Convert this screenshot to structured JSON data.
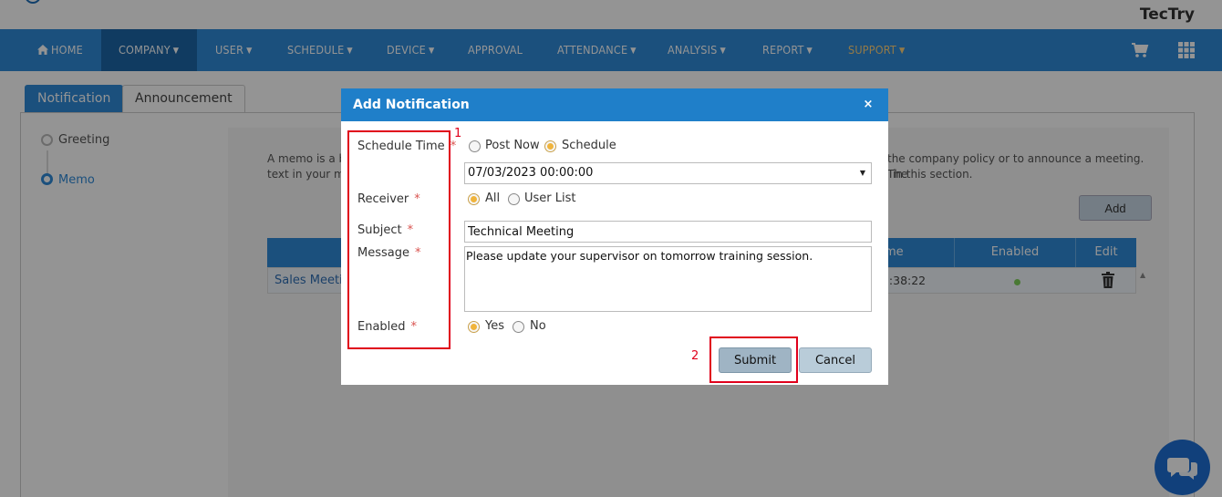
{
  "brand": "TecTry",
  "nav": {
    "items": [
      {
        "label": "HOME",
        "caret": false
      },
      {
        "label": "COMPANY",
        "caret": true
      },
      {
        "label": "USER",
        "caret": true
      },
      {
        "label": "SCHEDULE",
        "caret": true
      },
      {
        "label": "DEVICE",
        "caret": true
      },
      {
        "label": "APPROVAL",
        "caret": false
      },
      {
        "label": "ATTENDANCE",
        "caret": true
      },
      {
        "label": "ANALYSIS",
        "caret": true
      },
      {
        "label": "REPORT",
        "caret": true
      },
      {
        "label": "SUPPORT",
        "caret": true
      }
    ],
    "active": "COMPANY",
    "caret_glyph": "▼"
  },
  "tabs": [
    {
      "label": "Notification",
      "active": true
    },
    {
      "label": "Announcement",
      "active": false
    }
  ],
  "sidebar": {
    "items": [
      {
        "label": "Greeting",
        "active": false
      },
      {
        "label": "Memo",
        "active": true
      }
    ]
  },
  "memo": {
    "description_left": "A memo is a b",
    "description_left_2": "text in your m",
    "description_right": "the company policy or to announce a meeting. The",
    "description_right_2": "in this section.",
    "add_label": "Add"
  },
  "table": {
    "headers": {
      "time_partial": "me",
      "enabled": "Enabled",
      "edit": "Edit"
    },
    "rows": [
      {
        "subject": "Sales Meetin",
        "time_partial": "13:38:22",
        "enabled": true
      }
    ]
  },
  "modal": {
    "title": "Add Notification",
    "close_glyph": "×",
    "labels": {
      "schedule_time": "Schedule Time",
      "receiver": "Receiver",
      "subject": "Subject",
      "message": "Message",
      "enabled": "Enabled",
      "required_mark": "*"
    },
    "schedule_options": [
      {
        "label": "Post Now",
        "checked": false
      },
      {
        "label": "Schedule",
        "checked": true
      }
    ],
    "schedule_datetime": "07/03/2023 00:00:00",
    "receiver_options": [
      {
        "label": "All",
        "checked": true
      },
      {
        "label": "User List",
        "checked": false
      }
    ],
    "subject_value": "Technical Meeting",
    "message_value": "Please update your supervisor on tomorrow training session.",
    "enabled_options": [
      {
        "label": "Yes",
        "checked": true
      },
      {
        "label": "No",
        "checked": false
      }
    ],
    "submit_label": "Submit",
    "cancel_label": "Cancel"
  },
  "annotations": {
    "num1": "1",
    "num2": "2"
  },
  "colors": {
    "nav_bg": "#2f8ad8",
    "modal_header": "#1f7fc9",
    "annotation_red": "#e0001b",
    "radio_checked": "#f0b43c"
  }
}
